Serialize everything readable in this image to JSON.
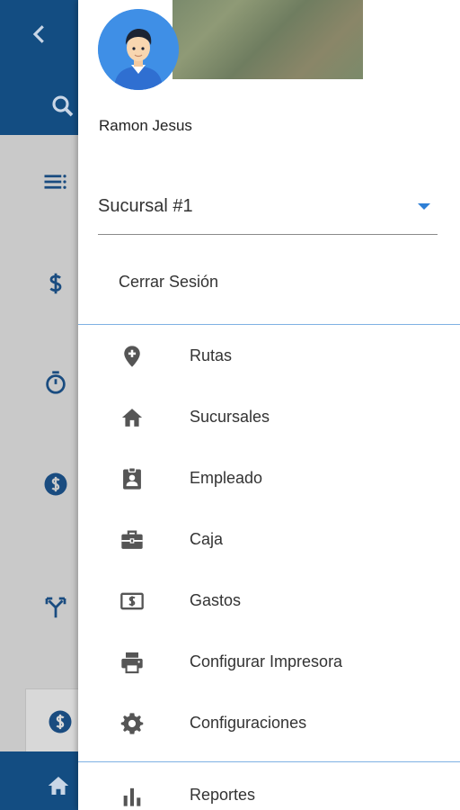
{
  "user": {
    "name": "Ramon Jesus"
  },
  "branch": {
    "selected": "Sucursal #1"
  },
  "logout_label": "Cerrar Sesión",
  "menu": {
    "items": [
      {
        "label": "Rutas",
        "icon": "add-location-icon"
      },
      {
        "label": "Sucursales",
        "icon": "home-icon"
      },
      {
        "label": "Empleado",
        "icon": "employee-badge-icon"
      },
      {
        "label": "Caja",
        "icon": "briefcase-icon"
      },
      {
        "label": "Gastos",
        "icon": "money-bill-icon"
      },
      {
        "label": "Configurar Impresora",
        "icon": "printer-icon"
      },
      {
        "label": "Configuraciones",
        "icon": "gear-icon"
      },
      {
        "label": "Reportes",
        "icon": "bar-chart-icon"
      }
    ]
  },
  "colors": {
    "primary": "#134d82",
    "accent": "#2e7fd6",
    "divider": "#7fb1e3",
    "icon": "#555555"
  }
}
